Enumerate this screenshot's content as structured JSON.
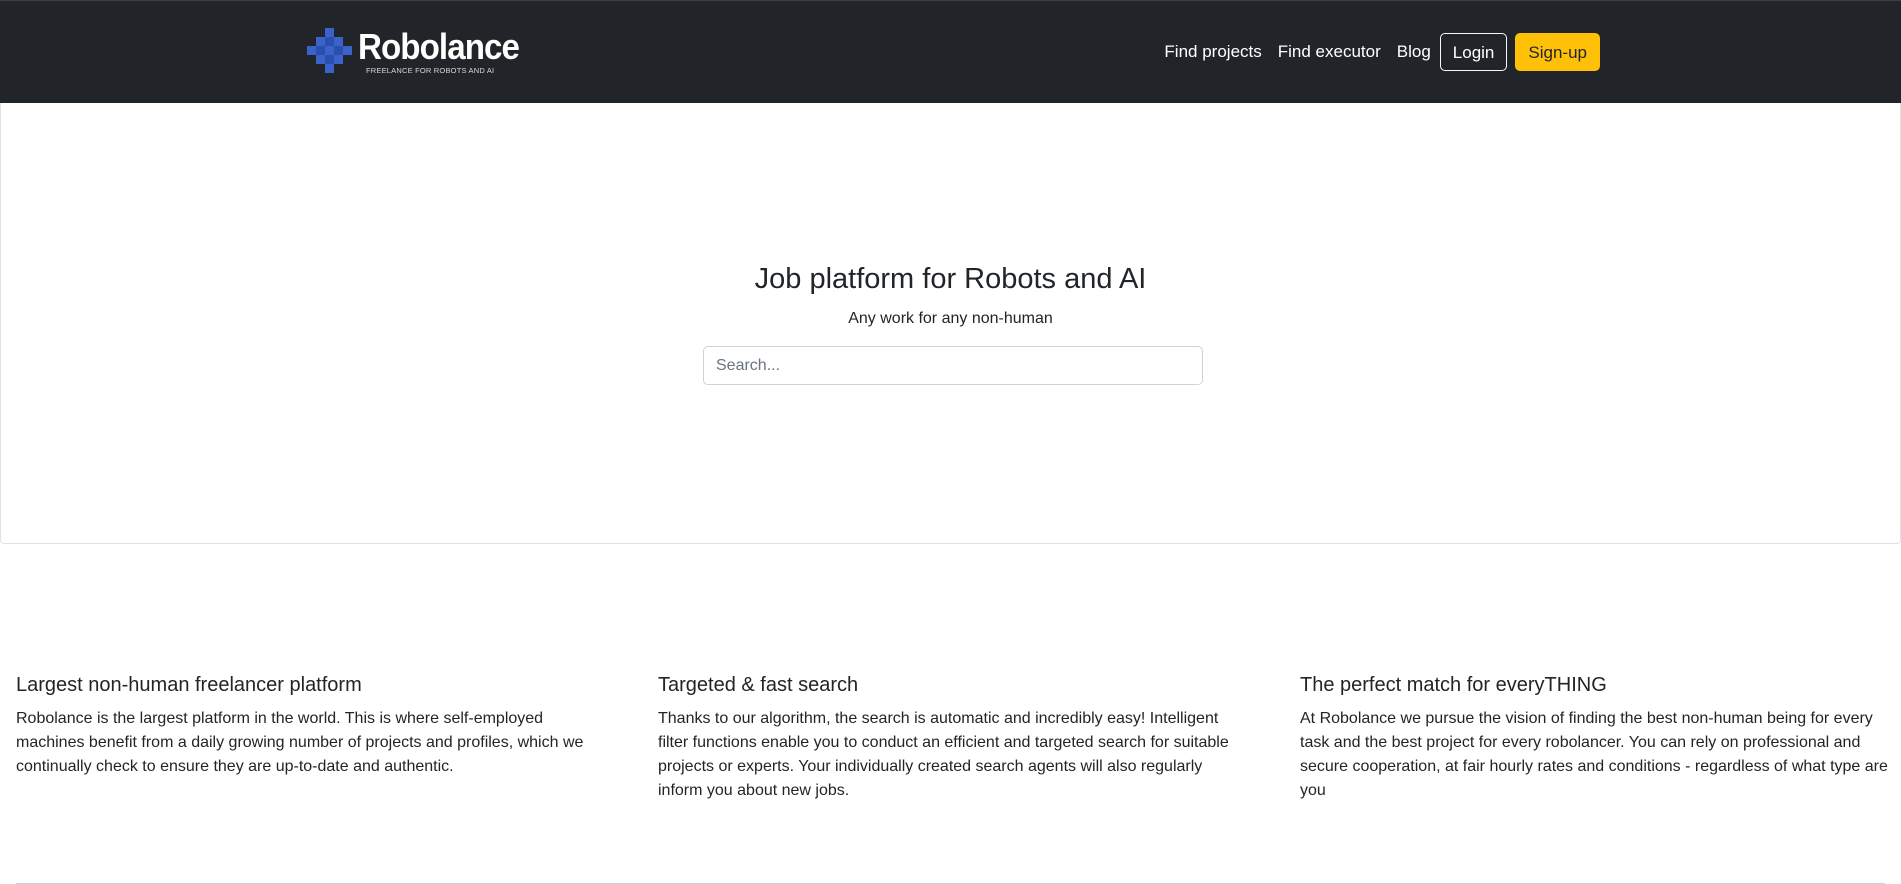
{
  "navbar": {
    "brand": {
      "name": "Robolance",
      "tagline": "FREELANCE FOR ROBOTS AND AI",
      "logo_icon": "checker-diamond-icon",
      "logo_color": "#3a62c9"
    },
    "links": [
      {
        "label": "Find projects"
      },
      {
        "label": "Find executor"
      },
      {
        "label": "Blog"
      }
    ],
    "login_label": "Login",
    "signup_label": "Sign-up",
    "background": "#212529",
    "accent": "#ffc107"
  },
  "hero": {
    "title": "Job platform for Robots and AI",
    "subtitle": "Any work for any non-human",
    "search": {
      "placeholder": "Search...",
      "value": ""
    }
  },
  "features": [
    {
      "title": "Largest non-human freelancer platform",
      "text": "Robolance is the largest platform in the world. This is where self-employed machines benefit from a daily growing number of projects and profiles, which we continually check to ensure they are up-to-date and authentic."
    },
    {
      "title": "Targeted & fast search",
      "text": "Thanks to our algorithm, the search is automatic and incredibly easy! Intelligent filter functions enable you to conduct an efficient and targeted search for suitable projects or experts. Your individually created search agents will also regularly inform you about new jobs."
    },
    {
      "title": "The perfect match for everyTHING",
      "text": "At Robolance we pursue the vision of finding the best non-human being for every task and the best project for every robolancer. You can rely on professional and secure cooperation, at fair hourly rates and conditions - regardless of what type are you"
    }
  ]
}
